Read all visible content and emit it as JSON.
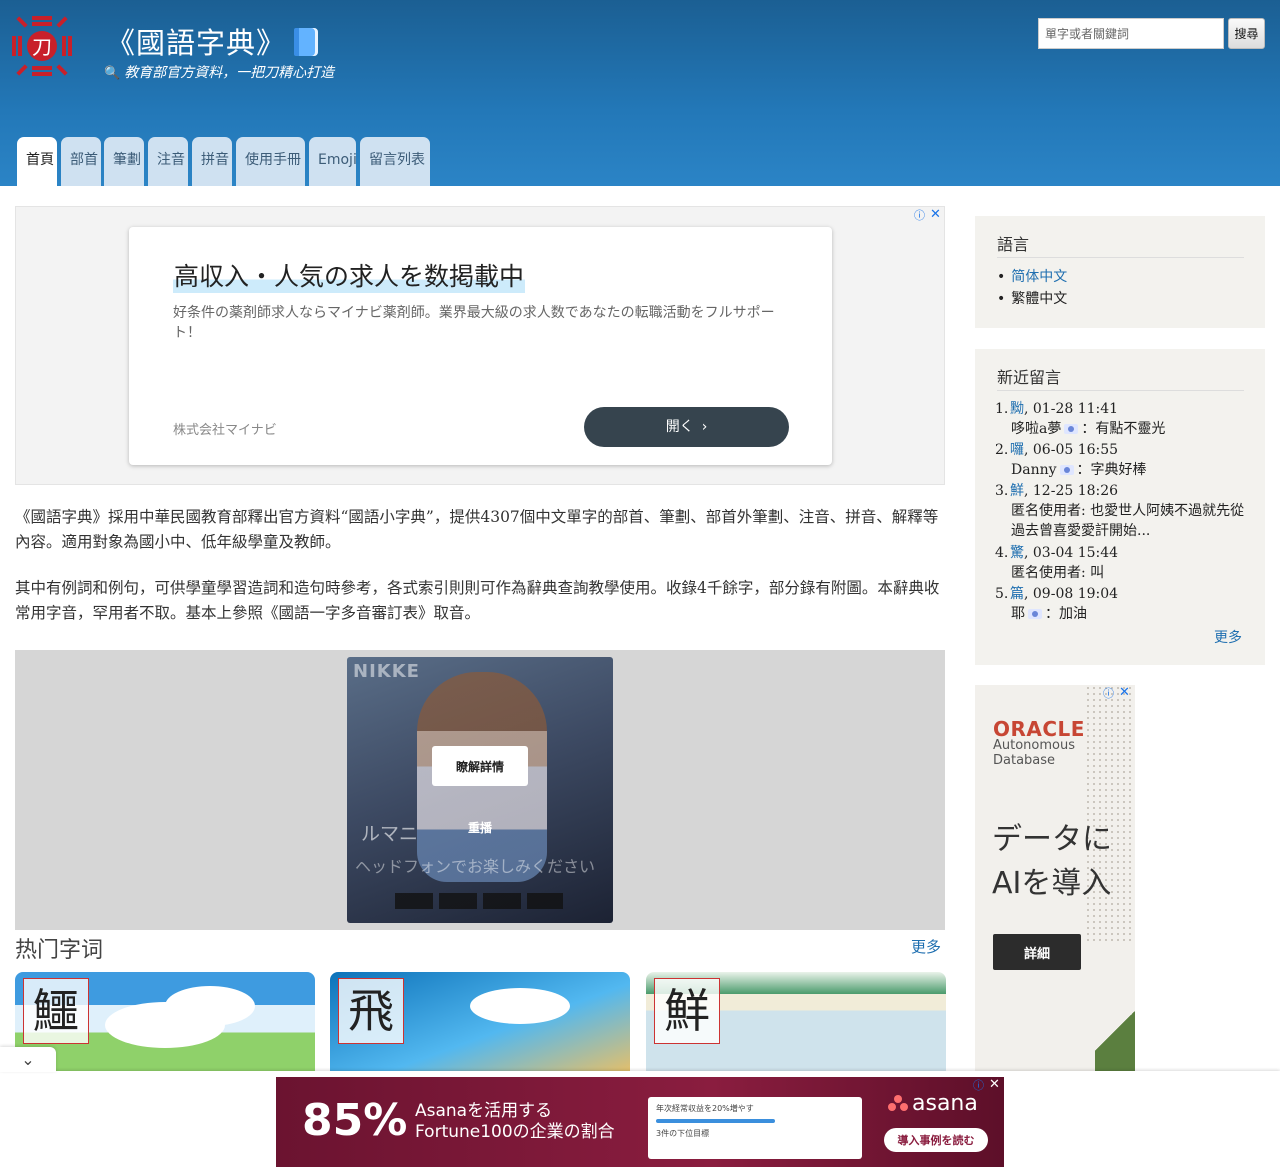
{
  "header": {
    "title": "《國語字典》",
    "tagline": "教育部官方資料，一把刀精心打造",
    "search_placeholder": "單字或者關鍵詞",
    "search_button": "搜尋",
    "brand_color": "#2378b8"
  },
  "tabs": [
    {
      "label": "首頁",
      "active": true
    },
    {
      "label": "部首",
      "active": false
    },
    {
      "label": "筆劃",
      "active": false
    },
    {
      "label": "注音",
      "active": false
    },
    {
      "label": "拼音",
      "active": false
    },
    {
      "label": "使用手冊",
      "active": false
    },
    {
      "label": "Emoji",
      "active": false
    },
    {
      "label": "留言列表",
      "active": false
    }
  ],
  "ad_top": {
    "headline": "高収入・人気の求人を数掲載中",
    "body": "好条件の薬剤師求人ならマイナビ薬剤師。業界最大級の求人数であなたの転職活動をフルサポート！",
    "sponsor": "株式会社マイナビ",
    "button": "開く"
  },
  "intro": {
    "p1": "《國語字典》採用中華民國教育部釋出官方資料“國語小字典”，提供4307個中文單字的部首、筆劃、部首外筆劃、注音、拼音、解釋等內容。適用對象為國小中、低年級學童及教師。",
    "p2": "其中有例詞和例句，可供學童學習造詞和造句時參考，各式索引則則可作為辭典查詢教學使用。收錄4千餘字，部分錄有附圖。本辭典收常用字音，罕用者不取。基本上參照《國語一字多音審訂表》取音。"
  },
  "ad_video": {
    "cta": "瞭解詳情",
    "replay": "重播",
    "name": "ルマニ",
    "subtitle": "ヘッドフォンでお楽しみください",
    "logo": "NIKKE"
  },
  "hot": {
    "title": "热门字词",
    "more": "更多",
    "cards": [
      {
        "char": "鱷"
      },
      {
        "char": "飛"
      },
      {
        "char": "鮮"
      }
    ]
  },
  "sidebar": {
    "lang_title": "語言",
    "lang_simplified": "简体中文",
    "lang_traditional": "繁體中文",
    "msg_title": "新近留言",
    "messages": [
      {
        "num": "1.",
        "char": "黝",
        "time": ", 01-28 11:41",
        "user": "哆啦a夢",
        "flag": true,
        "text": "：有點不靈光"
      },
      {
        "num": "2.",
        "char": "囉",
        "time": ", 06-05 16:55",
        "user": "Danny",
        "flag": true,
        "text": "：字典好棒"
      },
      {
        "num": "3.",
        "char": "鮮",
        "time": ", 12-25 18:26",
        "user": "匿名使用者",
        "flag": false,
        "text": ": 也愛世人阿姨不過就先從過去曾喜愛愛訐開始..."
      },
      {
        "num": "4.",
        "char": "驚",
        "time": ", 03-04 15:44",
        "user": "匿名使用者",
        "flag": false,
        "text": ": 叫"
      },
      {
        "num": "5.",
        "char": "篇",
        "time": ", 09-08 19:04",
        "user": "耶",
        "flag": true,
        "text": "：加油"
      }
    ],
    "more": "更多"
  },
  "ad_oracle": {
    "logo": "ORACLE",
    "sub": "Autonomous Database",
    "big": "データにAIを導入",
    "button": "詳細"
  },
  "ad_bottom": {
    "stat": "85%",
    "line1": "Asanaを活用する",
    "line2": "Fortune100の企業の割合",
    "mock_title": "年次経常収益を20%増やす",
    "mock_sub": "3件の下位目標",
    "logo": "asana",
    "button": "導入事例を読む"
  }
}
